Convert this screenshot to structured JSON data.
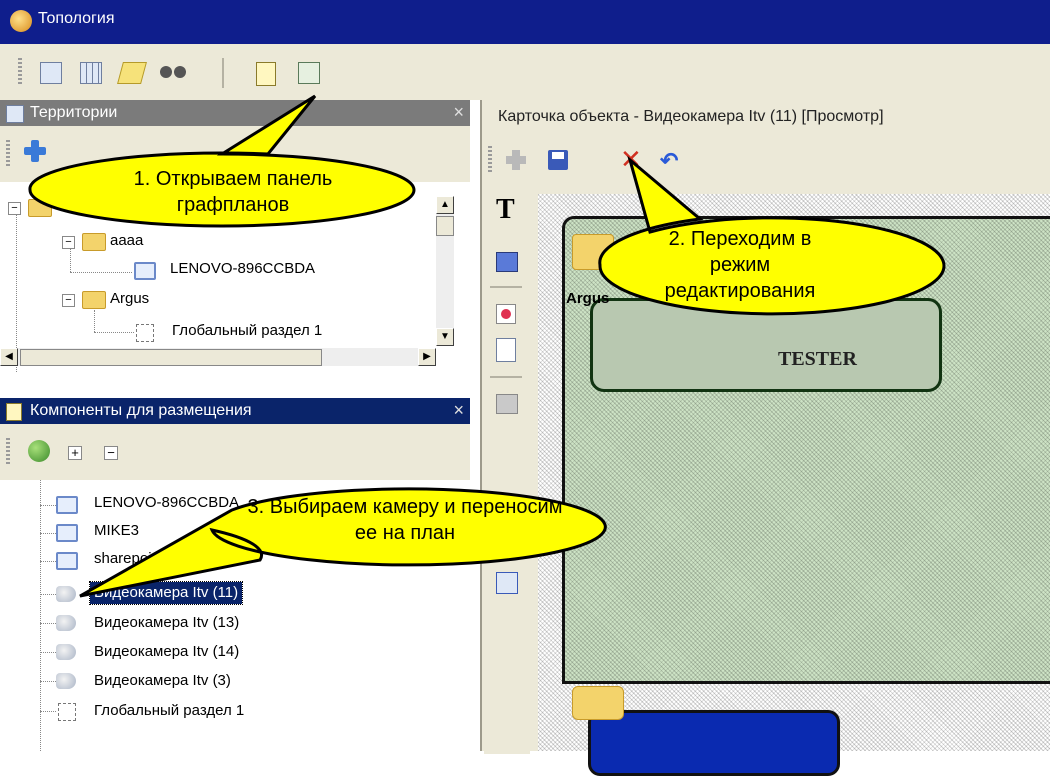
{
  "window": {
    "title": "Топология"
  },
  "toolbar": {
    "icons": [
      "tree-view-icon",
      "grid-icon",
      "notes-icon",
      "binoculars-icon",
      "card-icon",
      "plan-panel-icon"
    ]
  },
  "territories_panel": {
    "title": "Территории",
    "close": "×",
    "tree": {
      "row1": "аааа",
      "row2": "LENOVO-896CCBDA",
      "row3": "Argus",
      "row4": "Глобальный раздел 1"
    }
  },
  "components_panel": {
    "title": "Компоненты для размещения",
    "close": "×",
    "expand": "+",
    "collapse": "−",
    "items": [
      {
        "label": "LENOVO-896CCBDA"
      },
      {
        "label": "MIKE3"
      },
      {
        "label": "sharepoint"
      },
      {
        "label": "Видеокамера Itv (11)"
      },
      {
        "label": "Видеокамера Itv (13)"
      },
      {
        "label": "Видеокамера Itv (14)"
      },
      {
        "label": "Видеокамера Itv (3)"
      },
      {
        "label": "Глобальный раздел 1"
      }
    ]
  },
  "card": {
    "title": "Карточка объекта - Видеокамера Itv (11) [Просмотр]",
    "text_tool": "T",
    "plan_labels": {
      "folder": "Argus",
      "tester": "TESTER"
    }
  },
  "callouts": {
    "c1": "1. Открываем панель графпланов",
    "c2": "2. Переходим в режим редактирования",
    "c3": "3. Выбираем камеру и переносим ее на план"
  },
  "colors": {
    "titlebar": "#0f1e8c",
    "selection": "#0a246a",
    "callout": "#ffff00",
    "plan": "#cde3c5"
  }
}
